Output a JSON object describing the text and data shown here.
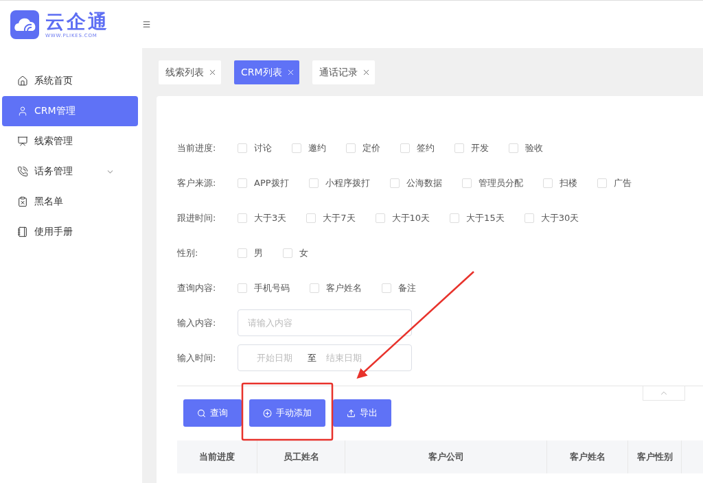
{
  "logo": {
    "name": "云企通",
    "url": "WWW.PLIKES.COM"
  },
  "sidebar": {
    "items": [
      {
        "label": "系统首页",
        "kind": "home",
        "selected": false
      },
      {
        "label": "CRM管理",
        "kind": "user",
        "selected": true
      },
      {
        "label": "线索管理",
        "kind": "board",
        "selected": false
      },
      {
        "label": "话务管理",
        "kind": "phone",
        "selected": false,
        "expanded": false
      },
      {
        "label": "黑名单",
        "kind": "blacklist",
        "selected": false
      },
      {
        "label": "使用手册",
        "kind": "book",
        "selected": false
      }
    ]
  },
  "tabs": [
    {
      "label": "线索列表",
      "selected": false
    },
    {
      "label": "CRM列表",
      "selected": true
    },
    {
      "label": "通话记录",
      "selected": false
    }
  ],
  "filters": [
    {
      "label": "当前进度:",
      "kind": "checkboxes",
      "options": [
        {
          "label": "讨论",
          "checked": false
        },
        {
          "label": "邀约",
          "checked": false
        },
        {
          "label": "定价",
          "checked": false
        },
        {
          "label": "签约",
          "checked": false
        },
        {
          "label": "开发",
          "checked": false
        },
        {
          "label": "验收",
          "checked": false
        }
      ]
    },
    {
      "label": "客户来源:",
      "kind": "checkboxes",
      "options": [
        {
          "label": "APP拨打",
          "checked": false
        },
        {
          "label": "小程序拨打",
          "checked": false
        },
        {
          "label": "公海数据",
          "checked": false
        },
        {
          "label": "管理员分配",
          "checked": false
        },
        {
          "label": "扫楼",
          "checked": false
        },
        {
          "label": "广告",
          "checked": false
        }
      ]
    },
    {
      "label": "跟进时间:",
      "kind": "checkboxes",
      "options": [
        {
          "label": "大于3天",
          "checked": false
        },
        {
          "label": "大于7天",
          "checked": false
        },
        {
          "label": "大于10天",
          "checked": false
        },
        {
          "label": "大于15天",
          "checked": false
        },
        {
          "label": "大于30天",
          "checked": false
        }
      ]
    },
    {
      "label": "性别:",
      "kind": "checkboxes",
      "options": [
        {
          "label": "男",
          "checked": false
        },
        {
          "label": "女",
          "checked": false
        }
      ]
    },
    {
      "label": "查询内容:",
      "kind": "checkboxes",
      "options": [
        {
          "label": "手机号码",
          "checked": false
        },
        {
          "label": "客户姓名",
          "checked": false
        },
        {
          "label": "备注",
          "checked": false
        }
      ]
    },
    {
      "label": "输入内容:",
      "kind": "input",
      "placeholder": "请输入内容"
    },
    {
      "label": "输入时间:",
      "kind": "daterange",
      "start_placeholder": "开始日期",
      "separator": "至",
      "end_placeholder": "结束日期"
    }
  ],
  "buttons": [
    {
      "label": "查询",
      "kind": "search"
    },
    {
      "label": "手动添加",
      "kind": "add"
    },
    {
      "label": "导出",
      "kind": "export"
    }
  ],
  "table": {
    "columns": [
      "当前进度",
      "员工姓名",
      "客户公司",
      "客户姓名",
      "客户性别"
    ]
  }
}
